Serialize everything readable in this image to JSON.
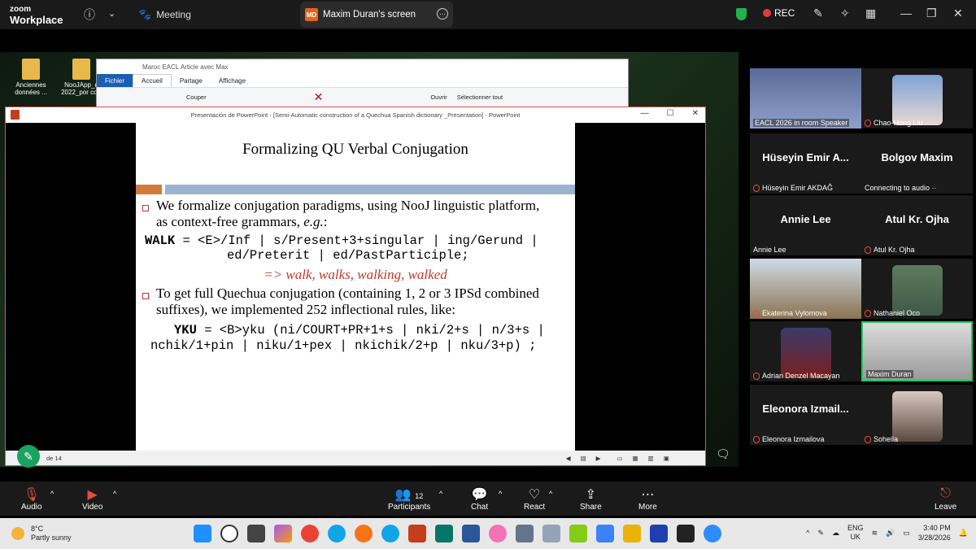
{
  "zoom": {
    "brand_top": "zoom",
    "brand_bottom": "Workplace",
    "meeting_label": "Meeting",
    "share_title": "Maxim Duran's screen",
    "share_badge": "MD",
    "rec_label": "REC"
  },
  "desktop": {
    "icons": [
      {
        "label": "Anciennes données ..."
      },
      {
        "label": "NooJApp_d 2022_por corr"
      }
    ]
  },
  "explorer": {
    "title": "Maroc EACL Article avec Max",
    "tabs": [
      "Fichier",
      "Accueil",
      "Partage",
      "Affichage"
    ],
    "ribbon": [
      "Couper",
      "Ouvrir",
      "Sélectionner tout"
    ]
  },
  "powerpoint": {
    "window_title": "Presentación de PowerPoint - [Semi-Automatic construction of a Quechua Spanish dictionary _Presentation] - PowerPoint",
    "slide_counter": "de 14",
    "slide": {
      "title": "Formalizing QU Verbal Conjugation",
      "bullet1_line1": "We formalize conjugation paradigms, using NooJ linguistic platform,",
      "bullet1_line2_a": "as context-free grammars, ",
      "bullet1_line2_b": "e.g.",
      "bullet1_line2_c": ":",
      "walk_kw": "WALK",
      "walk_line1": " = <E>/Inf | s/Present+3+singular | ing/Gerund |",
      "walk_line2": "ed/Preterit | ed/PastParticiple;",
      "result": "=> walk, walks, walking, walked",
      "bullet2_line1": "To get full Quechua conjugation (containing 1, 2 or 3 IPSd combined",
      "bullet2_line2": "suffixes), we implemented 252 inflectional rules, like:",
      "yku_kw": "YKU",
      "yku_line1": " = <B>yku (ni/COURT+PR+1+s | nki/2+s | n/3+s |",
      "yku_line2": "nchik/1+pin | niku/1+pex | nkichik/2+p | nku/3+p) ;"
    }
  },
  "gallery": {
    "tiles": [
      {
        "name": "EACL 2026 in room Speaker",
        "muted": false
      },
      {
        "name": "Chao-Hong Liu",
        "muted": true
      },
      {
        "big": "Hüseyin Emir A...",
        "name": "Hüseyin Emir AKDAĞ",
        "muted": true
      },
      {
        "big": "Bolgov Maxim",
        "name": "Connecting to audio ··",
        "muted": false
      },
      {
        "big": "Annie Lee",
        "name": "Annie Lee",
        "muted": false
      },
      {
        "big": "Atul Kr. Ojha",
        "name": "Atul Kr. Ojha",
        "muted": true
      },
      {
        "name": "Ekaterina Vylomova",
        "muted": true
      },
      {
        "name": "Nathaniel Oco",
        "muted": true
      },
      {
        "name": "Adrian Denzel Macayan",
        "muted": true
      },
      {
        "name": "Maxim Duran",
        "muted": false
      },
      {
        "big": "Eleonora Izmail...",
        "name": "Eleonora Izmailova",
        "muted": true
      },
      {
        "name": "Soheila",
        "muted": true
      }
    ]
  },
  "toolbar": {
    "audio": "Audio",
    "video": "Video",
    "participants": "Participants",
    "participants_count": "12",
    "chat": "Chat",
    "react": "React",
    "share": "Share",
    "more": "More",
    "leave": "Leave"
  },
  "taskbar": {
    "temp": "8°C",
    "weather": "Partly sunny",
    "lang1": "ENG",
    "lang2": "UK",
    "time": "3:40 PM",
    "date": "3/28/2026"
  },
  "colors": {
    "accent_red": "#c0392b",
    "zoom_green": "#1aa260",
    "active_speaker": "#22c55e"
  }
}
